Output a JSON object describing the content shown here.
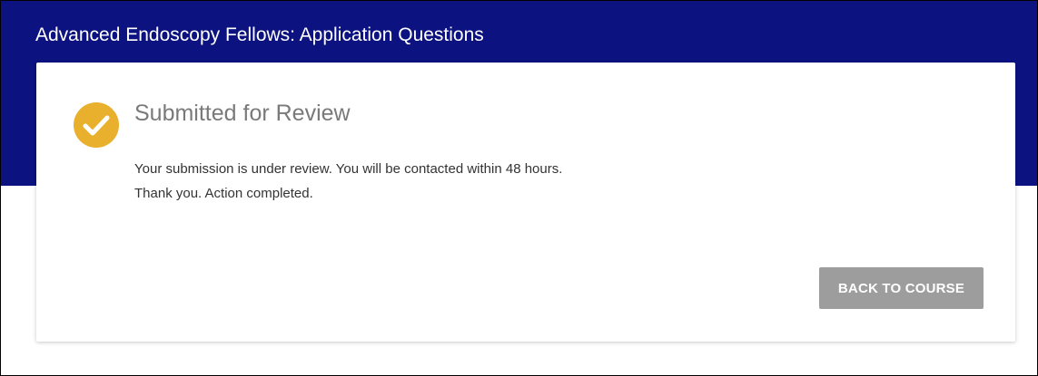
{
  "header": {
    "title": "Advanced Endoscopy Fellows: Application Questions"
  },
  "card": {
    "status_icon": "check-circle-icon",
    "status_title": "Submitted for Review",
    "message_line_1": "Your submission is under review. You will be contacted within 48 hours.",
    "message_line_2": "Thank you. Action completed.",
    "back_button_label": "BACK TO COURSE"
  },
  "colors": {
    "header_background": "#0c1280",
    "status_icon": "#e8b02c",
    "button_background": "#9d9d9d",
    "title_gray": "#7a7a7a"
  }
}
